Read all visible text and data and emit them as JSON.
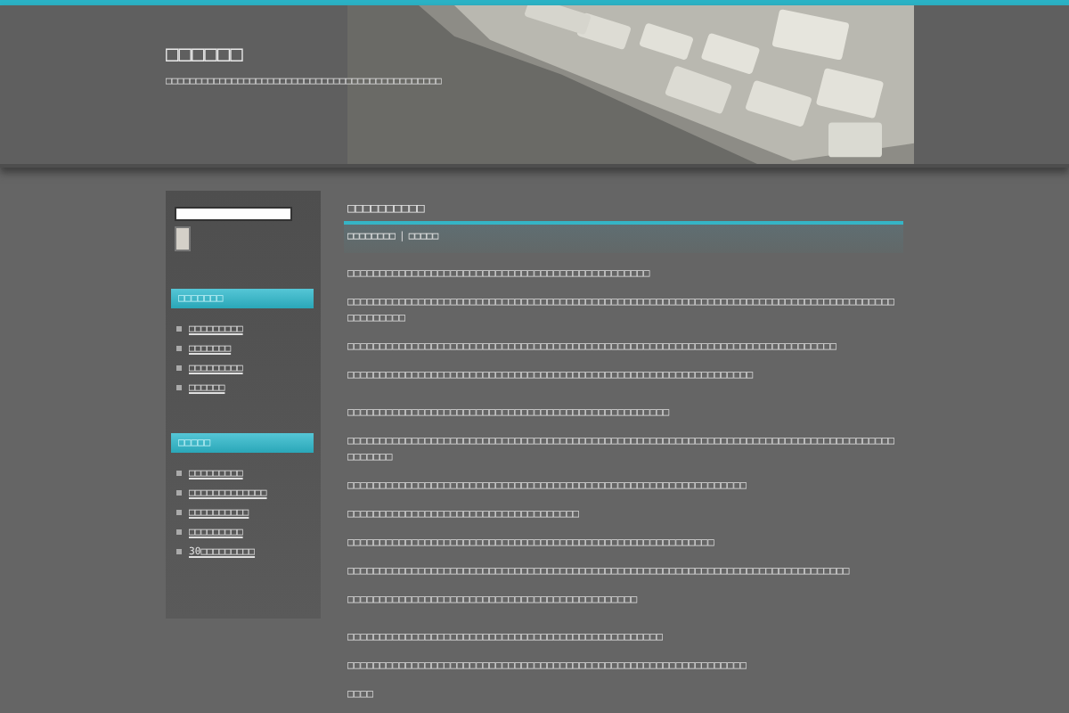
{
  "site": {
    "title": "□□□□□□",
    "tagline": "□□□□□□□□□□□□□□□□□□□□□□□□□□□□□□□□□□□□□□□□□□□□□□"
  },
  "sidebar": {
    "search": {
      "button": true
    },
    "widgets": [
      {
        "title": "□□□□□□□",
        "items": [
          "□□□□□□□□□",
          "□□□□□□□",
          "□□□□□□□□□",
          "□□□□□□"
        ]
      },
      {
        "title": "□□□□□",
        "items": [
          "□□□□□□□□□",
          "□□□□□□□□□□□□□",
          "□□□□□□□□□□",
          "□□□□□□□□□",
          "30□□□□□□□□□"
        ]
      }
    ]
  },
  "post": {
    "title": "□□□□□□□□□□",
    "meta": [
      "□□□□□□□□",
      "□□□□□"
    ],
    "meta_separator": "|",
    "sections": [
      [
        "□□□□□□□□□□□□□□□□□□□□□□□□□□□□□□□□□□□□□□□□□□□□□□□",
        "□□□□□□□□□□□□□□□□□□□□□□□□□□□□□□□□□□□□□□□□□□□□□□□□□□□□□□□□□□□□□□□□□□□□□□□□□□□□□□□□□□□□□□□□□□□□□□",
        "□□□□□□□□□□□□□□□□□□□□□□□□□□□□□□□□□□□□□□□□□□□□□□□□□□□□□□□□□□□□□□□□□□□□□□□□□□□□",
        "□□□□□□□□□□□□□□□□□□□□□□□□□□□□□□□□□□□□□□□□□□□□□□□□□□□□□□□□□□□□□□□"
      ],
      [
        "□□□□□□□□□□□□□□□□□□□□□□□□□□□□□□□□□□□□□□□□□□□□□□□□□□",
        "□□□□□□□□□□□□□□□□□□□□□□□□□□□□□□□□□□□□□□□□□□□□□□□□□□□□□□□□□□□□□□□□□□□□□□□□□□□□□□□□□□□□□□□□□□□□",
        "□□□□□□□□□□□□□□□□□□□□□□□□□□□□□□□□□□□□□□□□□□□□□□□□□□□□□□□□□□□□□□",
        "□□□□□□□□□□□□□□□□□□□□□□□□□□□□□□□□□□□□",
        "□□□□□□□□□□□□□□□□□□□□□□□□□□□□□□□□□□□□□□□□□□□□□□□□□□□□□□□□□",
        "□□□□□□□□□□□□□□□□□□□□□□□□□□□□□□□□□□□□□□□□□□□□□□□□□□□□□□□□□□□□□□□□□□□□□□□□□□□□□□",
        "□□□□□□□□□□□□□□□□□□□□□□□□□□□□□□□□□□□□□□□□□□□□□"
      ],
      [
        "□□□□□□□□□□□□□□□□□□□□□□□□□□□□□□□□□□□□□□□□□□□□□□□□□",
        "□□□□□□□□□□□□□□□□□□□□□□□□□□□□□□□□□□□□□□□□□□□□□□□□□□□□□□□□□□□□□□",
        "□□□□"
      ]
    ]
  }
}
